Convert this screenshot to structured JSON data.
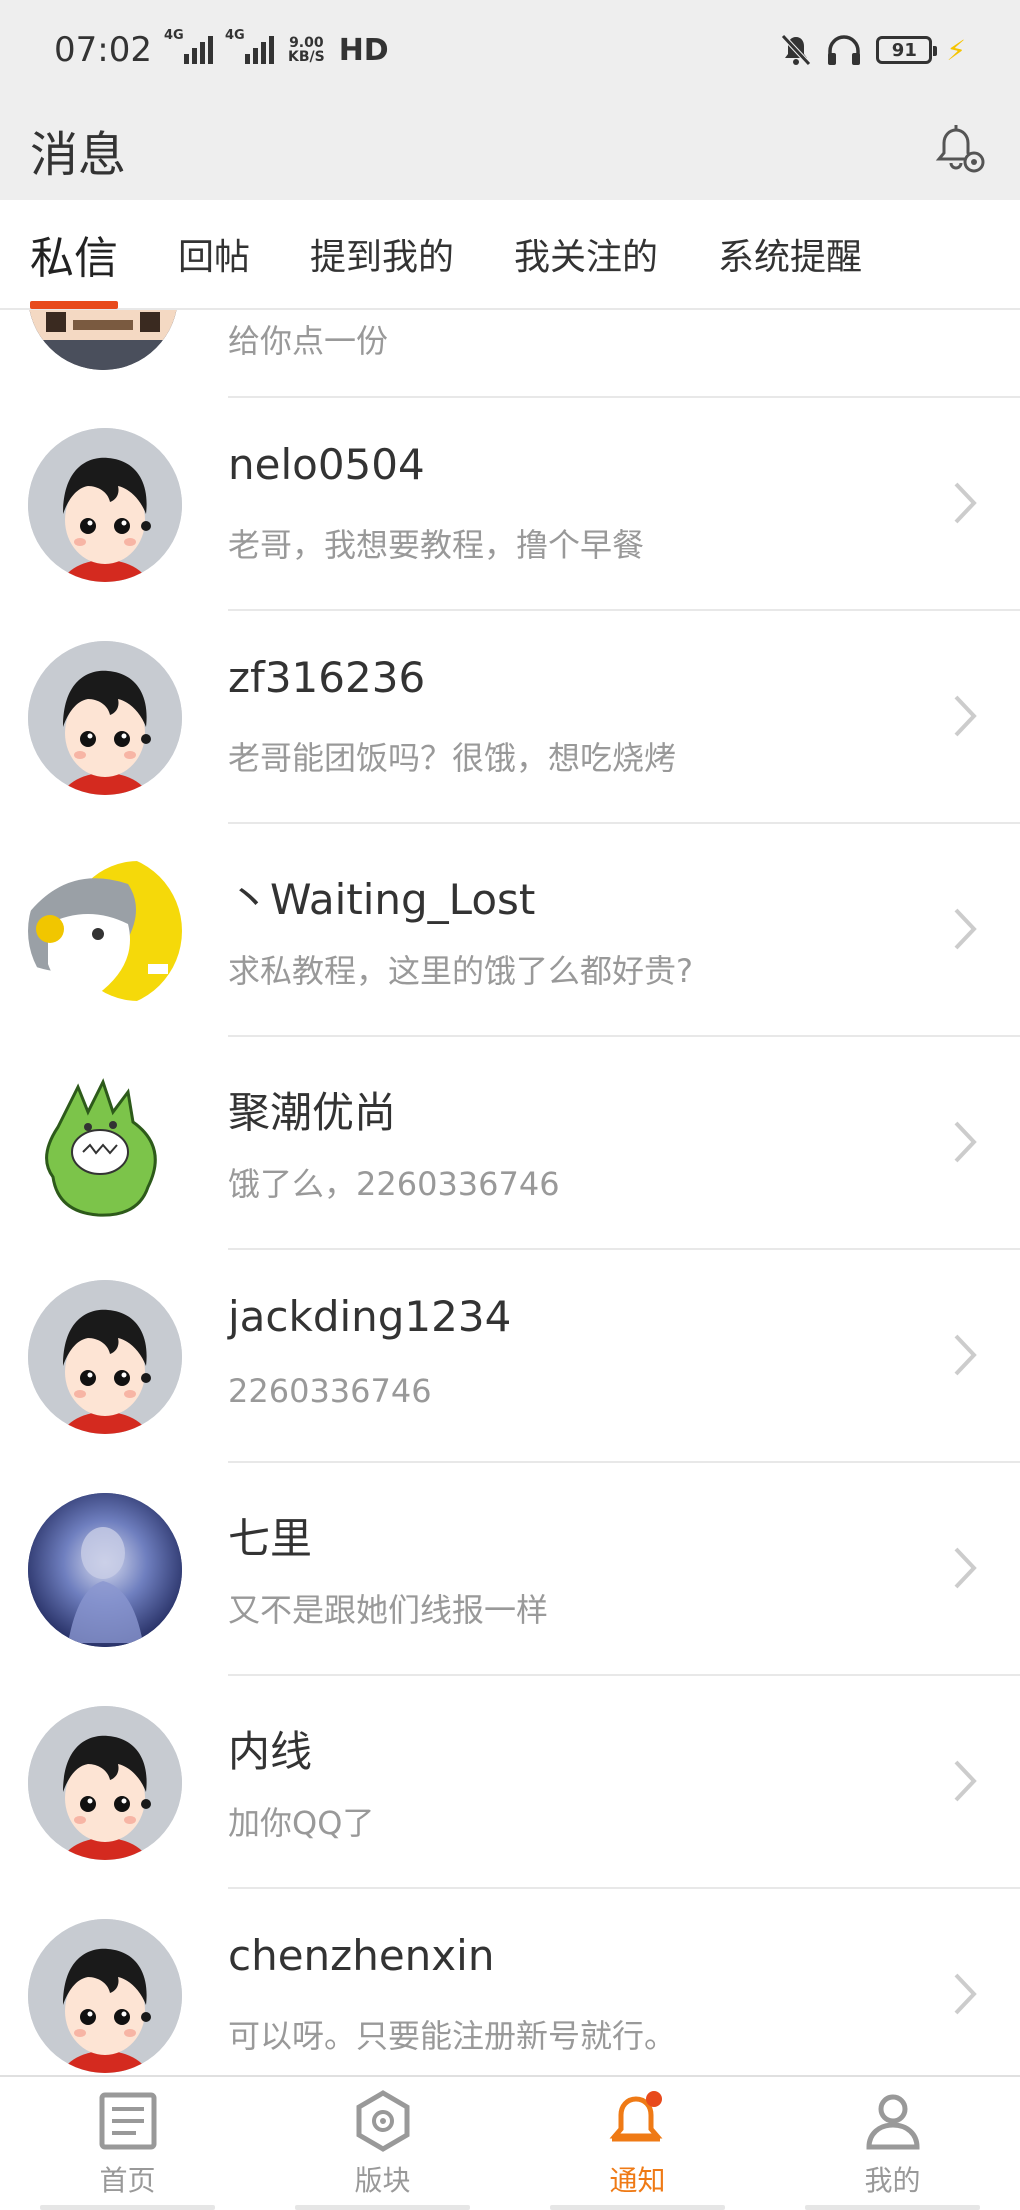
{
  "status_bar": {
    "time": "07:02",
    "net1": "4G",
    "net2": "4G",
    "speed_value": "9.00",
    "speed_unit": "KB/S",
    "hd": "HD",
    "battery": "91"
  },
  "header": {
    "title": "消息"
  },
  "tabs": [
    {
      "label": "私信"
    },
    {
      "label": "回帖"
    },
    {
      "label": "提到我的"
    },
    {
      "label": "我关注的"
    },
    {
      "label": "系统提醒"
    }
  ],
  "partial_message": {
    "preview": "给你点一份"
  },
  "messages": [
    {
      "name": "nelo0504",
      "preview": "老哥，我想要教程，撸个早餐",
      "avatar": "default"
    },
    {
      "name": "zf316236",
      "preview": "老哥能团饭吗？很饿，想吃烧烤",
      "avatar": "default"
    },
    {
      "name": "丶Waiting_Lost",
      "preview": "求私教程，这里的饿了么都好贵?",
      "avatar": "cartoon-yellow"
    },
    {
      "name": "聚潮优尚",
      "preview": "饿了么，2260336746",
      "avatar": "dinosaur"
    },
    {
      "name": "jackding1234",
      "preview": "2260336746",
      "avatar": "default"
    },
    {
      "name": "七里",
      "preview": "又不是跟她们线报一样",
      "avatar": "photo-blue"
    },
    {
      "name": "内线",
      "preview": "加你QQ了",
      "avatar": "default"
    },
    {
      "name": "chenzhenxin",
      "preview": "可以呀。只要能注册新号就行。",
      "avatar": "default"
    }
  ],
  "bottom_nav": [
    {
      "label": "首页",
      "icon": "home-list-icon"
    },
    {
      "label": "版块",
      "icon": "hexagon-icon"
    },
    {
      "label": "通知",
      "icon": "bell-icon"
    },
    {
      "label": "我的",
      "icon": "person-icon"
    }
  ],
  "colors": {
    "accent": "#ef7a15",
    "tab_indicator": "#e84a1c",
    "header_bg": "#eeeeee"
  }
}
